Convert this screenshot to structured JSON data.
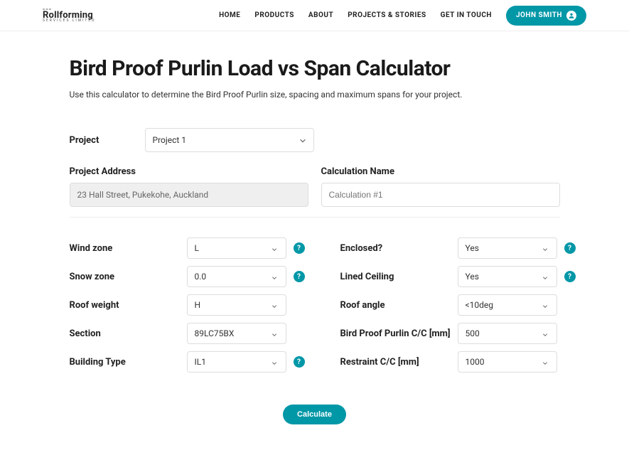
{
  "header": {
    "logo": {
      "main": "Rollforming",
      "sub": "SERVICES LIMITED"
    },
    "nav": [
      "HOME",
      "PRODUCTS",
      "ABOUT",
      "PROJECTS & STORIES",
      "GET IN TOUCH"
    ],
    "user": "JOHN SMITH"
  },
  "page": {
    "title": "Bird Proof Purlin Load vs Span Calculator",
    "subtitle": "Use this calculator to determine the Bird Proof Purlin size, spacing and maximum spans for your project."
  },
  "project": {
    "label": "Project",
    "selected": "Project 1",
    "address_label": "Project Address",
    "address_value": "23 Hall Street, Pukekohe, Auckland",
    "calc_label": "Calculation Name",
    "calc_placeholder": "Calculation #1"
  },
  "fields": {
    "left": [
      {
        "label": "Wind zone",
        "value": "L",
        "help": true
      },
      {
        "label": "Snow zone",
        "value": "0.0",
        "help": true
      },
      {
        "label": "Roof weight",
        "value": "H",
        "help": false
      },
      {
        "label": "Section",
        "value": "89LC75BX",
        "help": false
      },
      {
        "label": "Building Type",
        "value": "IL1",
        "help": true
      }
    ],
    "right": [
      {
        "label": "Enclosed?",
        "value": "Yes",
        "help": true
      },
      {
        "label": "Lined Ceiling",
        "value": "Yes",
        "help": true
      },
      {
        "label": "Roof angle",
        "value": "<10deg",
        "help": false
      },
      {
        "label": "Bird Proof Purlin C/C [mm]",
        "value": "500",
        "help": false
      },
      {
        "label": "Restraint C/C [mm]",
        "value": "1000",
        "help": false
      }
    ]
  },
  "actions": {
    "calculate": "Calculate"
  }
}
